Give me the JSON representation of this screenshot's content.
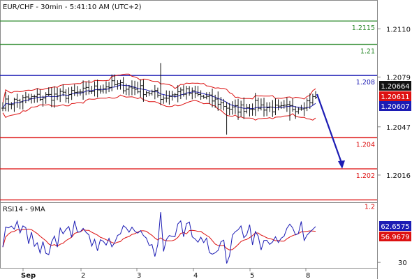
{
  "chart_data": [
    {
      "type": "line",
      "title": "EUR/CHF - 30min - 5:41:10 AM (UTC+2)",
      "ylim": [
        1.19985,
        1.21285
      ],
      "y_ticks": [
        "1.2110",
        "1.2079",
        "1.2047",
        "1.2016"
      ],
      "y_tick_values": [
        1.211,
        1.2079,
        1.2047,
        1.2016
      ],
      "x_ticks": [
        "Sep",
        "2",
        "3",
        "4",
        "5",
        "8"
      ],
      "levels": [
        {
          "label": "1.2115",
          "value": 1.2115,
          "color": "#2e8b2e"
        },
        {
          "label": "1.21",
          "value": 1.21,
          "color": "#2e8b2e"
        },
        {
          "label": "1.208",
          "value": 1.208,
          "color": "#1c1cb4"
        },
        {
          "label": "1.204",
          "value": 1.204,
          "color": "#dd1111"
        },
        {
          "label": "1.202",
          "value": 1.202,
          "color": "#dd1111"
        },
        {
          "label": "1.2",
          "value": 1.2,
          "color": "#dd1111"
        }
      ],
      "price_badges": [
        {
          "label": "1.20664",
          "value": 1.20664,
          "bg": "#111111",
          "fg": "#ffffff"
        },
        {
          "label": "1.20611",
          "value": 1.20611,
          "bg": "#dd1111",
          "fg": "#ffffff"
        },
        {
          "label": "1.20607",
          "value": 1.20607,
          "bg": "#1c1cb4",
          "fg": "#ffffff"
        }
      ],
      "forecast_arrow": {
        "from": [
          1.2068,
          "last"
        ],
        "to": 1.202,
        "color": "#1c1cb4"
      },
      "grid": false
    },
    {
      "type": "line",
      "title": "RSI14 - 9MA",
      "ylim": [
        25,
        85
      ],
      "y_ticks": [
        "30"
      ],
      "y_tick_values": [
        30
      ],
      "series": [
        {
          "name": "RSI14",
          "color": "#1c1cb4"
        },
        {
          "name": "9MA",
          "color": "#dd1111"
        }
      ],
      "value_badges": [
        {
          "label": "62.6575",
          "value": 62.6575,
          "bg": "#1c1cb4",
          "fg": "#ffffff"
        },
        {
          "label": "56.9679",
          "value": 56.9679,
          "bg": "#dd1111",
          "fg": "#ffffff"
        }
      ]
    }
  ]
}
